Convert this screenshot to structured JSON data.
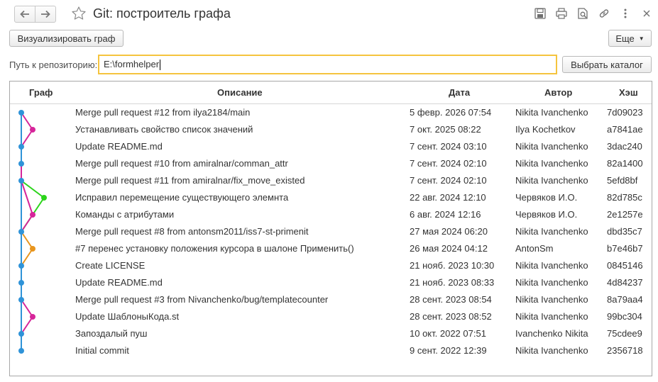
{
  "window": {
    "title": "Git: построитель графа",
    "icons": [
      "save-icon",
      "print-icon",
      "preview-icon",
      "link-icon",
      "more-vertical-icon",
      "close-icon"
    ]
  },
  "toolbar": {
    "visualize_label": "Визуализировать граф",
    "more_label": "Еще"
  },
  "repo": {
    "label": "Путь к репозиторию:",
    "path": "E:\\formhelper",
    "choose_label": "Выбрать каталог"
  },
  "table": {
    "headers": {
      "graph": "Граф",
      "description": "Описание",
      "date": "Дата",
      "author": "Автор",
      "hash": "Хэш"
    },
    "rows": [
      {
        "description": "Merge pull request #12 from ilya2184/main",
        "date": "5 февр. 2026 07:54",
        "author": "Nikita Ivanchenko",
        "hash": "7d09023"
      },
      {
        "description": "Устанавливать свойство список значений",
        "date": "7 окт. 2025 08:22",
        "author": "Ilya Kochetkov",
        "hash": "a7841ae"
      },
      {
        "description": "Update README.md",
        "date": "7 сент. 2024 03:10",
        "author": "Nikita Ivanchenko",
        "hash": "3dac240"
      },
      {
        "description": "Merge pull request #10 from amiralnar/comman_attr",
        "date": "7 сент. 2024 02:10",
        "author": "Nikita Ivanchenko",
        "hash": "82a1400"
      },
      {
        "description": "Merge pull request #11 from amiralnar/fix_move_existed",
        "date": "7 сент. 2024 02:10",
        "author": "Nikita Ivanchenko",
        "hash": "5efd8bf"
      },
      {
        "description": "Исправил перемещение существующего элемнта",
        "date": "22 авг. 2024 12:10",
        "author": "Червяков И.О.",
        "hash": "82d785c"
      },
      {
        "description": "Команды с атрибутами",
        "date": "6 авг. 2024 12:16",
        "author": "Червяков И.О.",
        "hash": "2e1257e"
      },
      {
        "description": "Merge pull request #8 from antonsm2011/iss7-st-primenit",
        "date": "27 мая 2024 06:20",
        "author": "Nikita Ivanchenko",
        "hash": "dbd35c7"
      },
      {
        "description": "#7 перенес установку положения курсора в шалоне Применить()",
        "date": "26 мая 2024 04:12",
        "author": "AntonSm",
        "hash": "b7e46b7"
      },
      {
        "description": "Create LICENSE",
        "date": "21 нояб. 2023 10:30",
        "author": "Nikita Ivanchenko",
        "hash": "0845146"
      },
      {
        "description": "Update README.md",
        "date": "21 нояб. 2023 08:33",
        "author": "Nikita Ivanchenko",
        "hash": "4d84237"
      },
      {
        "description": "Merge pull request #3 from Nivanchenko/bug/templatecounter",
        "date": "28 сент. 2023 08:54",
        "author": "Nikita Ivanchenko",
        "hash": "8a79aa4"
      },
      {
        "description": "Update ШаблоныКода.st",
        "date": "28 сент. 2023 08:52",
        "author": "Nikita Ivanchenko",
        "hash": "99bc304"
      },
      {
        "description": "Запоздалый пуш",
        "date": "10 окт. 2022 07:51",
        "author": "Ivanchenko Nikita",
        "hash": "75cdee9"
      },
      {
        "description": "Initial commit",
        "date": "9 сент. 2022 12:39",
        "author": "Nikita Ivanchenko",
        "hash": "2356718"
      }
    ]
  },
  "graph": {
    "colors": {
      "main": "#2f93d8",
      "magenta": "#d6259a",
      "green": "#2bd41a",
      "orange": "#e8951d"
    },
    "commit_lane": [
      0,
      1,
      0,
      0,
      0,
      2,
      1,
      0,
      1,
      0,
      0,
      0,
      1,
      0,
      0
    ],
    "commit_color": [
      "main",
      "magenta",
      "main",
      "main",
      "main",
      "green",
      "magenta",
      "main",
      "orange",
      "main",
      "main",
      "main",
      "magenta",
      "main",
      "main"
    ],
    "edges": [
      {
        "from": 0,
        "to": 1,
        "color": "magenta"
      },
      {
        "from": 1,
        "to": 2,
        "color": "magenta"
      },
      {
        "from": 3,
        "to": 4,
        "color": "magenta"
      },
      {
        "from": 4,
        "to": 6,
        "color": "magenta"
      },
      {
        "from": 4,
        "to": 5,
        "color": "green"
      },
      {
        "from": 5,
        "to": 7,
        "color": "green"
      },
      {
        "from": 6,
        "to": 7,
        "color": "magenta"
      },
      {
        "from": 7,
        "to": 8,
        "color": "orange"
      },
      {
        "from": 8,
        "to": 9,
        "color": "orange"
      },
      {
        "from": 11,
        "to": 12,
        "color": "magenta"
      },
      {
        "from": 12,
        "to": 13,
        "color": "magenta"
      }
    ]
  }
}
